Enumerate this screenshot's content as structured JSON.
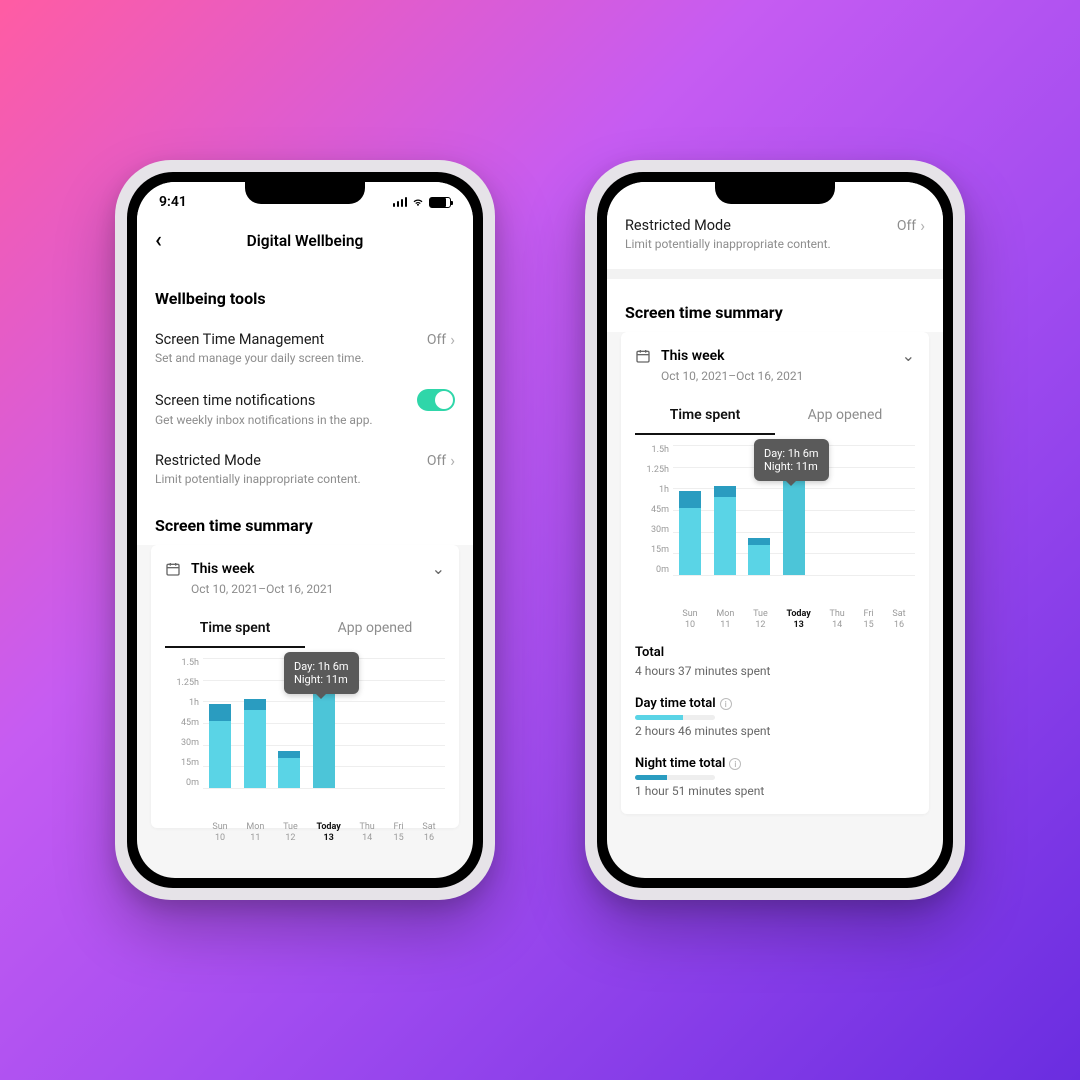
{
  "status": {
    "time": "9:41"
  },
  "nav": {
    "title": "Digital Wellbeing"
  },
  "tools": {
    "heading": "Wellbeing tools",
    "screen_time_mgmt": {
      "label": "Screen Time Management",
      "value": "Off",
      "sub": "Set and manage your daily screen time."
    },
    "notifications": {
      "label": "Screen time notifications",
      "sub": "Get weekly inbox notifications in the app."
    },
    "restricted": {
      "label": "Restricted Mode",
      "value": "Off",
      "sub": "Limit potentially inappropriate content."
    }
  },
  "summary": {
    "heading": "Screen time summary",
    "week_label": "This week",
    "week_range": "Oct 10, 2021–Oct 16, 2021",
    "tab_time": "Time spent",
    "tab_opened": "App opened",
    "tooltip_day": "Day: 1h  6m",
    "tooltip_night": "Night: 11m",
    "totals": {
      "total_label": "Total",
      "total_value": "4 hours 37 minutes spent",
      "day_label": "Day time total",
      "day_value": "2 hours 46 minutes spent",
      "night_label": "Night time total",
      "night_value": "1 hour 51 minutes spent"
    }
  },
  "chart_data": {
    "type": "bar",
    "xlabel": "",
    "ylabel": "",
    "ylim": [
      0,
      1.5
    ],
    "y_ticks": [
      "1.5h",
      "1.25h",
      "1h",
      "45m",
      "30m",
      "15m",
      "0m"
    ],
    "categories": [
      "Sun 10",
      "Mon 11",
      "Tue 12",
      "Today 13",
      "Thu 14",
      "Fri 15",
      "Sat 16"
    ],
    "series": [
      {
        "name": "Day",
        "values": [
          0.77,
          0.9,
          0.35,
          1.1,
          0,
          0,
          0
        ]
      },
      {
        "name": "Night",
        "values": [
          0.2,
          0.13,
          0.08,
          0.18,
          0,
          0,
          0
        ]
      }
    ],
    "selected_index": 3
  }
}
